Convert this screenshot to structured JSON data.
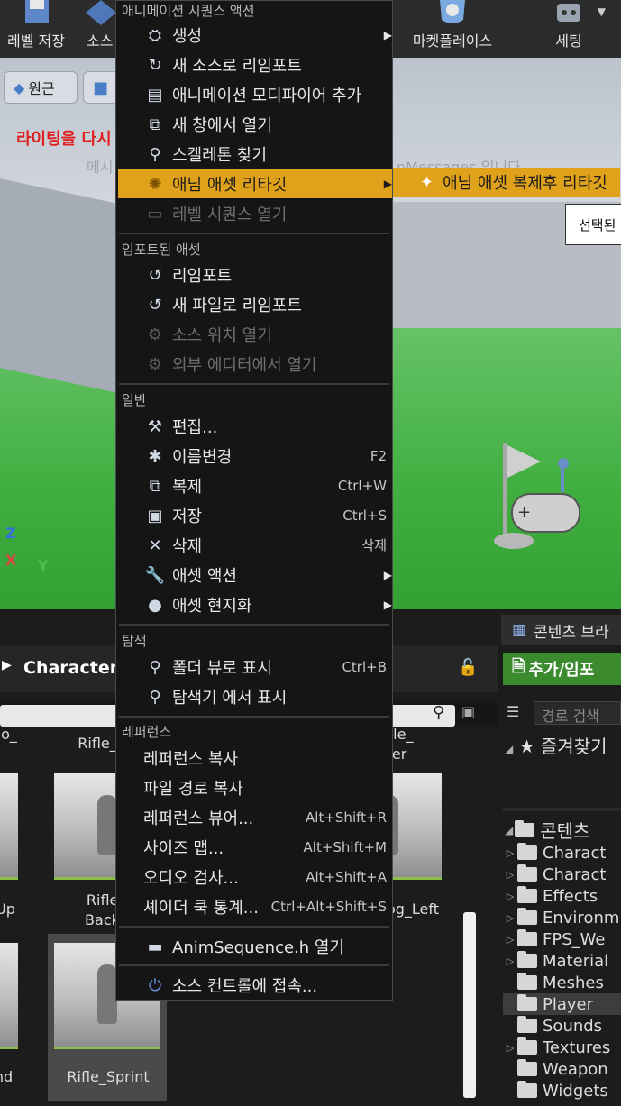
{
  "toolbar": {
    "save_level": "레벨 저장",
    "source": "소스",
    "marketplace": "마켓플레이스",
    "settings": "세팅"
  },
  "viewport": {
    "perspective_label": "원근",
    "lighting_warning": "라이팅을 다시",
    "message_left": "메시",
    "message_right": "nMessages 입니다",
    "selected_label": "선택된",
    "axis_x": "X",
    "axis_y": "Y",
    "axis_z": "Z"
  },
  "context_menu": {
    "header_anim": "애니메이션 시퀀스 액션",
    "items_anim": [
      {
        "label": "생성",
        "icon": "create-icon",
        "submenu": true
      },
      {
        "label": "새 소스로 리임포트",
        "icon": "reimport-new-source-icon"
      },
      {
        "label": "애니메이션 모디파이어 추가",
        "icon": "modifier-icon"
      },
      {
        "label": "새 창에서 열기",
        "icon": "new-window-icon"
      },
      {
        "label": "스켈레톤 찾기",
        "icon": "find-skeleton-icon"
      },
      {
        "label": "애님 애셋 리타깃",
        "icon": "retarget-icon",
        "submenu": true,
        "highlighted": true
      },
      {
        "label": "레벨 시퀀스 열기",
        "icon": "level-sequence-icon",
        "disabled": true
      }
    ],
    "header_imported": "임포트된 애셋",
    "items_imported": [
      {
        "label": "리임포트",
        "icon": "reimport-icon"
      },
      {
        "label": "새 파일로 리임포트",
        "icon": "reimport-file-icon"
      },
      {
        "label": "소스 위치 열기",
        "icon": "open-source-location-icon",
        "disabled": true
      },
      {
        "label": "외부 에디터에서 열기",
        "icon": "external-editor-icon",
        "disabled": true
      }
    ],
    "header_general": "일반",
    "items_general": [
      {
        "label": "편집...",
        "icon": "edit-icon"
      },
      {
        "label": "이름변경",
        "icon": "rename-icon",
        "shortcut": "F2"
      },
      {
        "label": "복제",
        "icon": "duplicate-icon",
        "shortcut": "Ctrl+W"
      },
      {
        "label": "저장",
        "icon": "save-icon",
        "shortcut": "Ctrl+S"
      },
      {
        "label": "삭제",
        "icon": "delete-icon",
        "shortcut": "삭제"
      },
      {
        "label": "애셋 액션",
        "icon": "wrench-icon",
        "submenu": true
      },
      {
        "label": "애셋 현지화",
        "icon": "globe-icon",
        "submenu": true
      }
    ],
    "header_explore": "탐색",
    "items_explore": [
      {
        "label": "폴더 뷰로 표시",
        "icon": "folder-view-icon",
        "shortcut": "Ctrl+B"
      },
      {
        "label": "탐색기 에서 표시",
        "icon": "explorer-icon"
      }
    ],
    "header_references": "레퍼런스",
    "items_references": [
      {
        "label": "레퍼런스 복사"
      },
      {
        "label": "파일 경로 복사"
      },
      {
        "label": "레퍼런스 뷰어...",
        "shortcut": "Alt+Shift+R"
      },
      {
        "label": "사이즈 맵...",
        "shortcut": "Alt+Shift+M"
      },
      {
        "label": "오디오 검사...",
        "shortcut": "Alt+Shift+A"
      },
      {
        "label": "셰이더 쿡 통계...",
        "shortcut": "Ctrl+Alt+Shift+S"
      }
    ],
    "item_open_header": "AnimSequence.h 열기",
    "item_source_control": "소스 컨트롤에 접속..."
  },
  "submenu": {
    "label": "애님 애셋 복제후 리타깃"
  },
  "content_browser": {
    "path_label": "Character",
    "assets_top_row": [
      "Rifle_",
      "ldle_\nter"
    ],
    "asset_mid_left_label": "Up",
    "asset_mid": "Rifle_J\nBackw",
    "asset_mid_right": "og_Left",
    "asset_bottom_left": "nd",
    "asset_bottom": "Rifle_Sprint",
    "asset_top_left": "o_"
  },
  "content_panel": {
    "tab_title": "콘텐츠 브라",
    "add_import": "추가/임포",
    "path_search_placeholder": "경로 검색",
    "favorites": "즐겨찾기",
    "content_root": "콘텐츠",
    "folders": [
      {
        "name": "Charact",
        "expandable": true
      },
      {
        "name": "Charact",
        "expandable": true
      },
      {
        "name": "Effects",
        "expandable": true
      },
      {
        "name": "Environm",
        "expandable": true
      },
      {
        "name": "FPS_We",
        "expandable": true
      },
      {
        "name": "Material",
        "expandable": true
      },
      {
        "name": "Meshes",
        "expandable": false
      },
      {
        "name": "Player",
        "expandable": false,
        "selected": true
      },
      {
        "name": "Sounds",
        "expandable": false
      },
      {
        "name": "Textures",
        "expandable": true
      },
      {
        "name": "Weapon",
        "expandable": false
      },
      {
        "name": "Widgets",
        "expandable": false
      }
    ]
  }
}
